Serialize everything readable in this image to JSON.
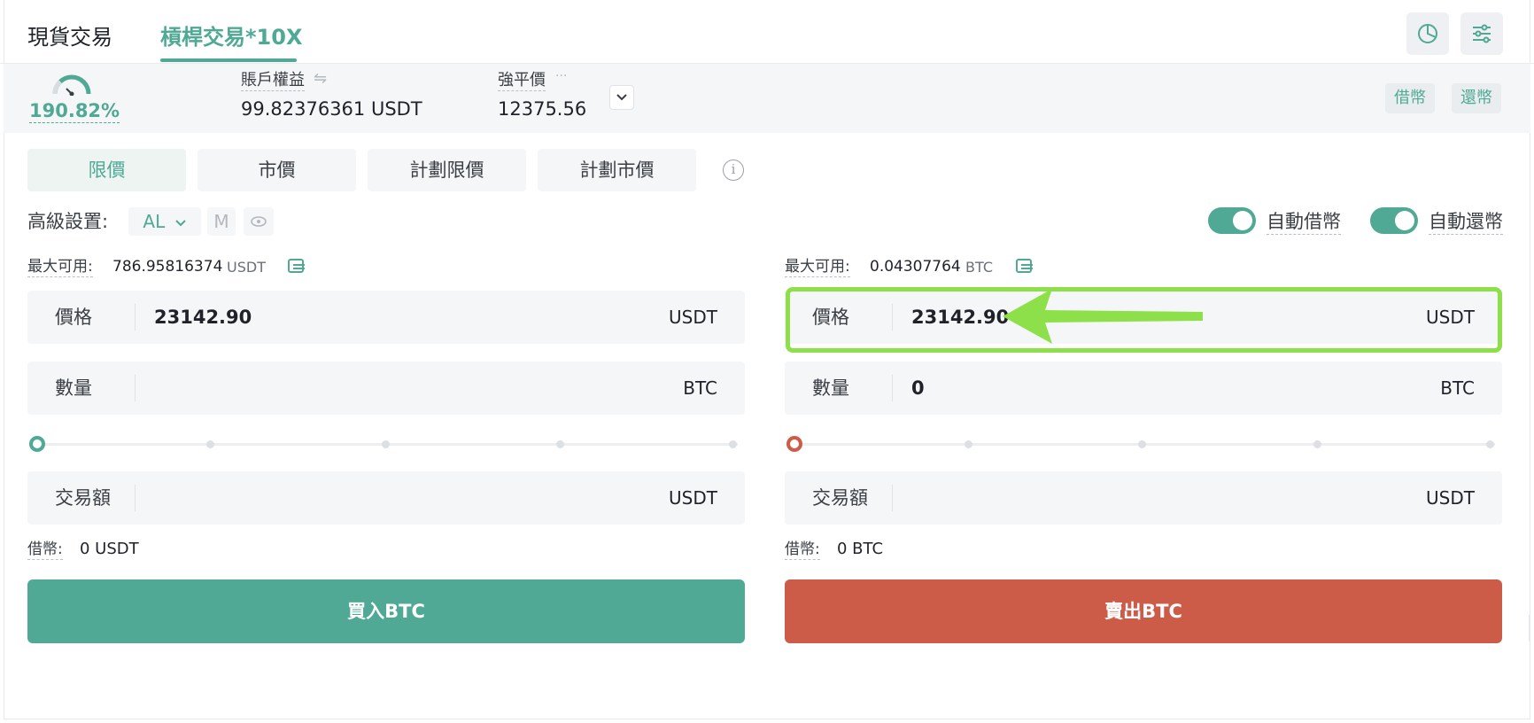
{
  "tabs": {
    "spot": "現貨交易",
    "margin": "槓桿交易*10X"
  },
  "account": {
    "risk_rate": "190.82%",
    "equity_label": "賬戶權益",
    "equity_value": "99.82376361 USDT",
    "liquidation_label": "強平價",
    "liquidation_value": "12375.56",
    "borrow_btn": "借幣",
    "repay_btn": "還幣"
  },
  "order_types": [
    "限價",
    "市價",
    "計劃限價",
    "計劃市價"
  ],
  "advanced": {
    "label": "高級設置:",
    "al_chip": "AL",
    "m_chip": "M",
    "auto_borrow": "自動借幣",
    "auto_repay": "自動還幣"
  },
  "buy": {
    "max_label": "最大可用:",
    "max_value": "786.95816374",
    "max_unit": "USDT",
    "price_label": "價格",
    "price_value": "23142.90",
    "price_unit": "USDT",
    "amount_label": "數量",
    "amount_value": "",
    "amount_unit": "BTC",
    "total_label": "交易額",
    "total_unit": "USDT",
    "borrow_label": "借幣:",
    "borrow_value": "0 USDT",
    "button": "買入BTC",
    "slider_percent": 0
  },
  "sell": {
    "max_label": "最大可用:",
    "max_value": "0.04307764",
    "max_unit": "BTC",
    "price_label": "價格",
    "price_value": "23142.90",
    "price_unit": "USDT",
    "amount_label": "數量",
    "amount_value": "0",
    "amount_unit": "BTC",
    "total_label": "交易額",
    "total_unit": "USDT",
    "borrow_label": "借幣:",
    "borrow_value": "0 BTC",
    "button": "賣出BTC",
    "slider_percent": 0
  },
  "colors": {
    "accent": "#4fa994",
    "sell": "#cc5c48",
    "highlight": "#8ee04a"
  },
  "icons": [
    "pie-chart-icon",
    "settings-sliders-icon",
    "gauge-icon",
    "swap-icon",
    "more-icon",
    "chevron-down-icon",
    "info-icon",
    "eye-icon",
    "wallet-transfer-icon",
    "arrow-annotation-icon"
  ]
}
